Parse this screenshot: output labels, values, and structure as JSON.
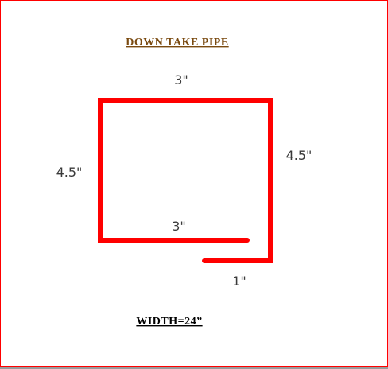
{
  "title": "DOWN  TAKE  PIPE",
  "footer": "WIDTH=24”",
  "colors": {
    "shape": "#ff0000",
    "title": "#7a4a10",
    "dimension_text": "#3a3a3a",
    "footer": "#000000",
    "frame": "#ff0000"
  },
  "dimensions": {
    "top": "3\"",
    "left": "4.5\"",
    "right": "4.5\"",
    "inner_bottom": "3\"",
    "lip": "1\""
  }
}
